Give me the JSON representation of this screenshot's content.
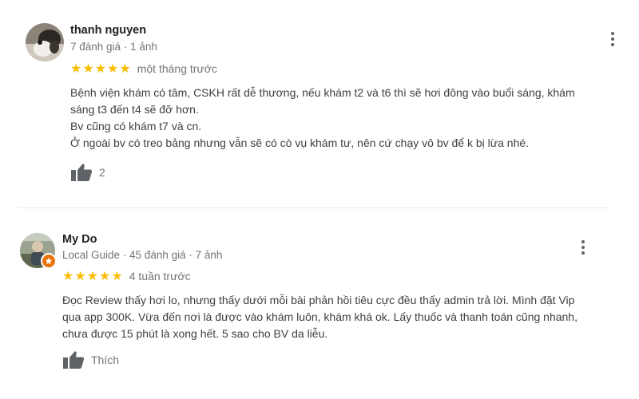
{
  "reviews": [
    {
      "author": "thanh nguyen",
      "meta": "7 đánh giá · 1 ảnh",
      "rating": 5,
      "time": "một tháng trước",
      "lines": [
        "Bệnh viện khám có tâm, CSKH rất dễ thương, nếu khám t2 và t6  thì sẽ hơi đông vào buổi sáng, khám",
        "sáng t3 đến t4 sẽ đỡ hơn.",
        "Bv cũng có khám t7 và cn.",
        "Ở ngoài bv có treo bảng nhưng vẫn sẽ có cò vụ khám tư, nên cứ chạy vô bv để k bị lừa nhé."
      ],
      "like_label": "2"
    },
    {
      "author": "My Do",
      "meta": "Local Guide · 45 đánh giá · 7 ảnh",
      "rating": 5,
      "time": "4 tuần trước",
      "lines": [
        "Đọc Review thấy hơi lo, nhưng thấy dưới mỗi bài phản hồi tiêu cực đều thấy admin trả lời. Mình đặt Vip",
        "qua app 300K. Vừa đến nơi là được vào khám luôn, khám khá ok. Lấy thuốc và thanh toán cũng nhanh,",
        "chưa được 15 phút là xong hết. 5 sao cho BV da liễu."
      ],
      "like_label": "Thích"
    }
  ],
  "icons": {
    "star": "star-icon",
    "like": "thumbs-up-icon",
    "more": "more-vert-icon",
    "guide_badge": "local-guide-star-icon"
  },
  "colors": {
    "star": "#fbbc04",
    "meta": "#70757a",
    "like_icon": "#5f6368",
    "guide_badge": "#e8710a"
  }
}
